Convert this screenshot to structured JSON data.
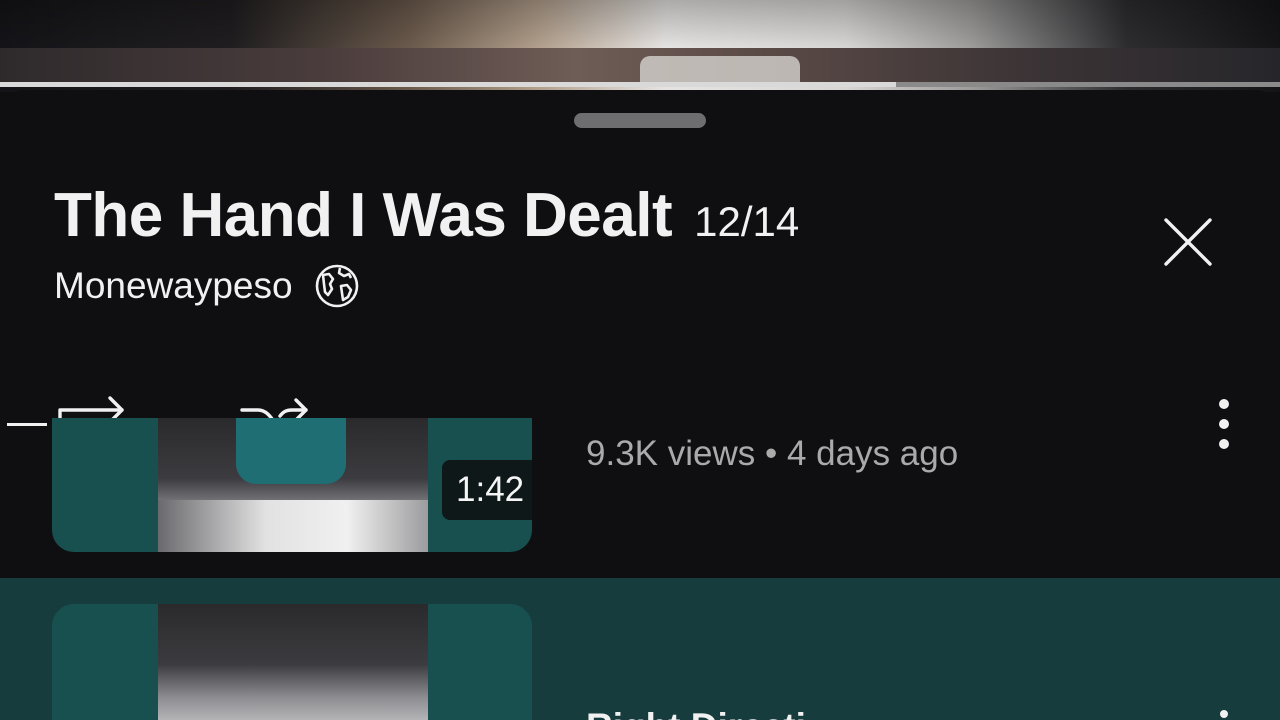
{
  "video": {
    "progress": 0.7
  },
  "playlist": {
    "title": "The Hand I Was Dealt",
    "position": "12/14",
    "channel": "Monewaypeso",
    "visibility_icon": "globe-icon"
  },
  "controls": {
    "loop_icon": "loop-icon",
    "shuffle_icon": "shuffle-icon",
    "more_icon": "more-vert-icon",
    "close_icon": "close-icon"
  },
  "items": [
    {
      "duration": "1:42",
      "meta": "9.3K views • 4 days ago",
      "title": ""
    },
    {
      "duration": "",
      "meta": "",
      "title": "Right Directi"
    }
  ],
  "colors": {
    "background": "#0f0f12",
    "accent_teal": "#18504f",
    "selected_row": "#173c3e",
    "text_primary": "#f1f1f1",
    "text_secondary": "#aaaaaa"
  }
}
